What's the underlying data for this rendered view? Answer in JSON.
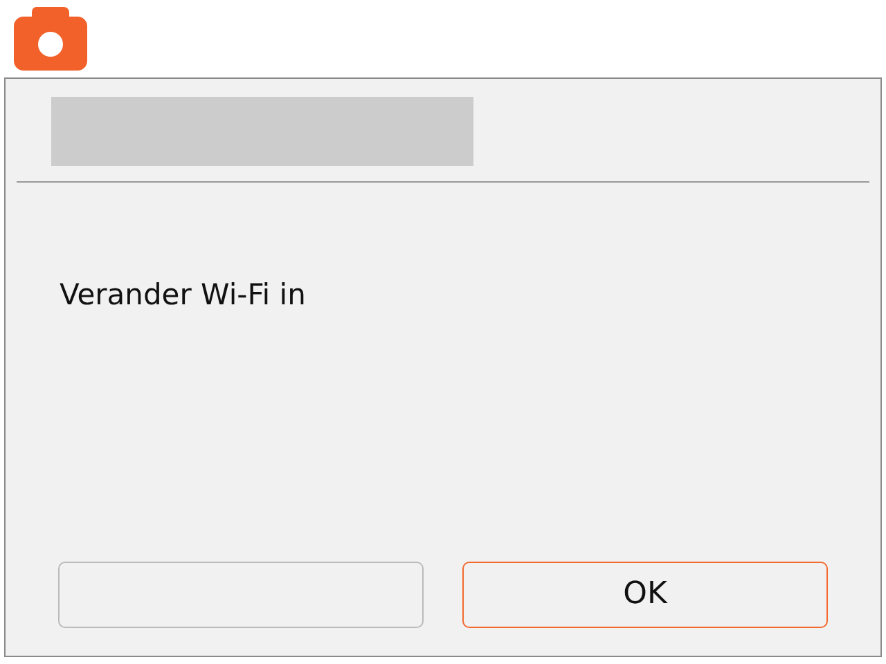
{
  "dialog": {
    "message": "Verander Wi-Fi in"
  },
  "buttons": [
    {
      "selected": false
    },
    {
      "label": "OK",
      "selected": true
    }
  ]
}
